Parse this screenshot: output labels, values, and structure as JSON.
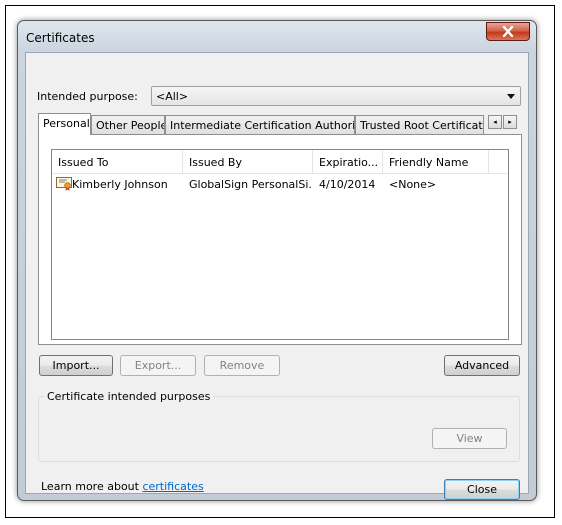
{
  "window": {
    "title": "Certificates"
  },
  "intended_purpose": {
    "label": "Intended purpose:",
    "value": "<All>"
  },
  "tabs": [
    {
      "label": "Personal",
      "active": true
    },
    {
      "label": "Other People"
    },
    {
      "label": "Intermediate Certification Authorities"
    },
    {
      "label": "Trusted Root Certification Authorities"
    }
  ],
  "tab_scroll": {
    "left": "◂",
    "right": "▸"
  },
  "table": {
    "columns": [
      "Issued To",
      "Issued By",
      "Expiratio...",
      "Friendly Name"
    ],
    "rows": [
      {
        "issued_to": "Kimberly Johnson",
        "issued_by": "GlobalSign PersonalSi...",
        "expiration": "4/10/2014",
        "friendly_name": "<None>",
        "icon": "certificate-icon"
      }
    ]
  },
  "buttons": {
    "import": "Import...",
    "export": "Export...",
    "remove": "Remove",
    "advanced": "Advanced",
    "view": "View",
    "close": "Close"
  },
  "group": {
    "title": "Certificate intended purposes"
  },
  "footer": {
    "learn_more_text": "Learn more about",
    "link_text": "certificates"
  },
  "colors": {
    "close_button": "#c23a20",
    "link": "#0066cc",
    "default_button_border": "#3c7fb1"
  }
}
